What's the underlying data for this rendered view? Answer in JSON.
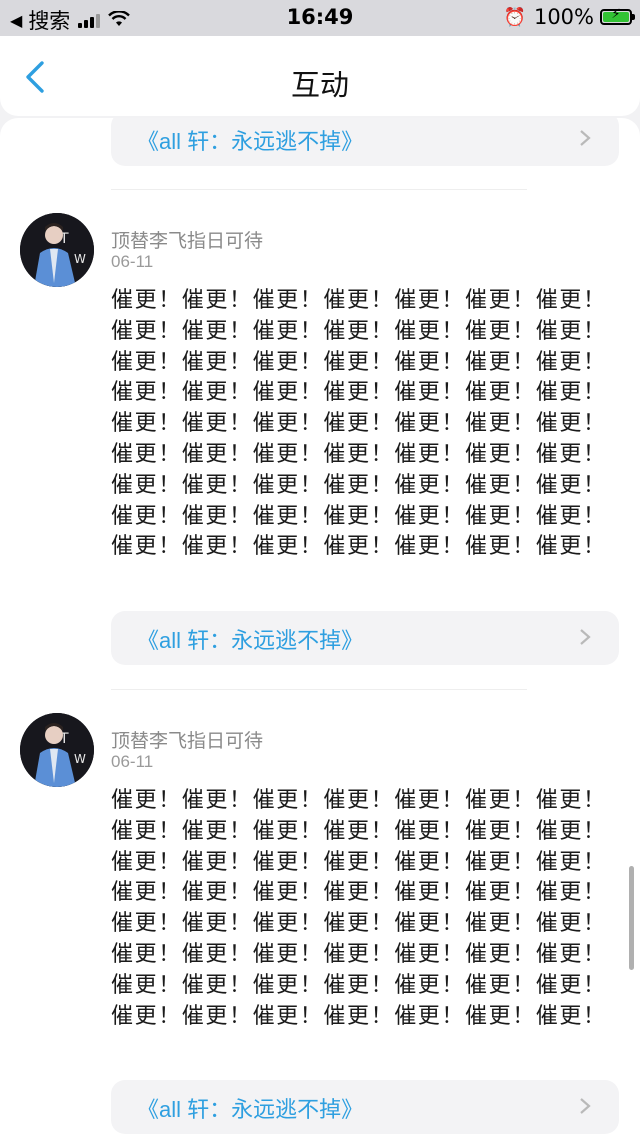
{
  "status_bar": {
    "back_app": "搜索",
    "time": "16:49",
    "battery": "100%"
  },
  "nav": {
    "title": "互动"
  },
  "source_label": "《all 轩：永远逃不掉》",
  "comments": [
    {
      "username": "顶替李飞指日可待",
      "date": "06-11",
      "text": "催更！催更！催更！催更！催更！催更！催更！催更！催更！催更！催更！催更！催更！催更！催更！催更！催更！催更！催更！催更！催更！催更！催更！催更！催更！催更！催更！催更！催更！催更！催更！催更！催更！催更！催更！催更！催更！催更！催更！催更！催更！催更！催更！催更！催更！催更！催更！催更！催更！催更！催更！催更！催更！催更！催更！催更！催更！催更！催更！催更！催更！催更！催更！"
    },
    {
      "username": "顶替李飞指日可待",
      "date": "06-11",
      "text": "催更！催更！催更！催更！催更！催更！催更！催更！催更！催更！催更！催更！催更！催更！催更！催更！催更！催更！催更！催更！催更！催更！催更！催更！催更！催更！催更！催更！催更！催更！催更！催更！催更！催更！催更！催更！催更！催更！催更！催更！催更！催更！催更！催更！催更！催更！催更！催更！催更！催更！催更！催更！催更！催更！催更！催更！"
    }
  ]
}
